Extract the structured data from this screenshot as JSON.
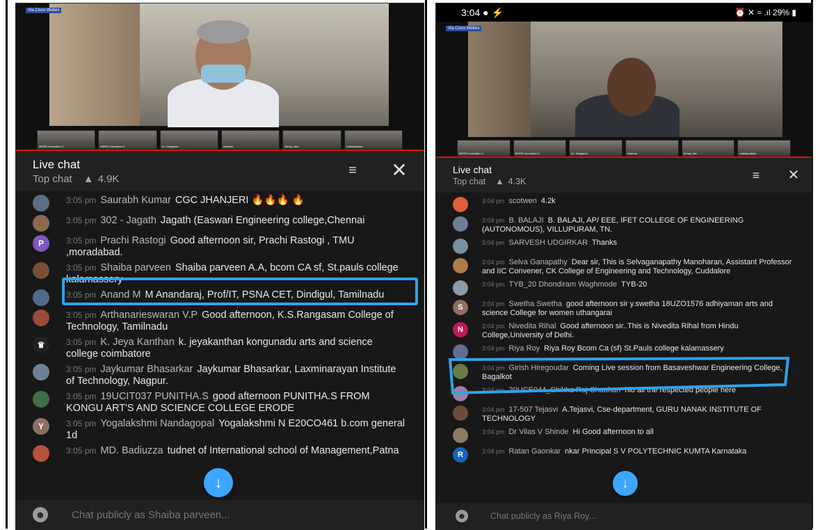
{
  "left": {
    "watermark": "Via Cisco Webex",
    "thumbs": [
      "MHRD Innovation C",
      "MHRD Innovation C",
      "Dr. Dangaran",
      "ishanan",
      "Abhay Jain",
      "mahlapraklas"
    ],
    "chat_title": "Live chat",
    "chat_mode": "Top chat",
    "viewer_count": "4.9K",
    "messages": [
      {
        "time": "3:05 pm",
        "author": "Saurabh Kumar",
        "text": "CGC JHANJERI 🔥🔥🔥 🔥",
        "avatar_color": "#5b6e86",
        "avatar_letter": ""
      },
      {
        "time": "3:05 pm",
        "author": "302 - Jagath",
        "text": "Jagath (Easwari Engineering college,Chennai",
        "avatar_color": "#8b6a4e",
        "avatar_letter": ""
      },
      {
        "time": "3:05 pm",
        "author": "Prachi Rastogi",
        "text": "Good afternoon sir, Prachi Rastogi , TMU ,moradabad.",
        "avatar_color": "#7e57c2",
        "avatar_letter": "P"
      },
      {
        "time": "3:05 pm",
        "author": "Shaiba parveen",
        "text": "Shaiba parveen A.A, bcom CA sf, St.pauls college kalamassery",
        "avatar_color": "#7a4e36",
        "avatar_letter": ""
      },
      {
        "time": "3:05 pm",
        "author": "Anand M",
        "text": "M Anandaraj, Prof/IT, PSNA CET, Dindigul, Tamilnadu",
        "avatar_color": "#4f6a8a",
        "avatar_letter": ""
      },
      {
        "time": "3:05 pm",
        "author": "Arthanarieswaran V.P",
        "text": "Good afternoon, K.S.Rangasam College of Technology, Tamilnadu",
        "avatar_color": "#9a4b3c",
        "avatar_letter": ""
      },
      {
        "time": "3:05 pm",
        "author": "K. Jeya Kanthan",
        "text": "k. jeyakanthan kongunadu arts and science college coimbatore",
        "avatar_color": "#222222",
        "avatar_letter": "♛"
      },
      {
        "time": "3:05 pm",
        "author": "Jaykumar Bhasarkar",
        "text": "Jaykumar Bhasarkar, Laxminarayan Institute of Technology, Nagpur.",
        "avatar_color": "#6c7f96",
        "avatar_letter": ""
      },
      {
        "time": "3:05 pm",
        "author": "19UCIT037 PUNITHA.S",
        "text": "good afternoon PUNITHA.S FROM KONGU ART'S AND SCIENCE COLLEGE ERODE",
        "avatar_color": "#3f6e4a",
        "avatar_letter": ""
      },
      {
        "time": "3:05 pm",
        "author": "Yogalakshmi Nandagopal",
        "text": "Yogalakshmi N E20CO461 b.com general 1d",
        "avatar_color": "#8d6e63",
        "avatar_letter": "Y"
      },
      {
        "time": "3:05 pm",
        "author": "MD. Badiuzza",
        "text": "tudnet of International school of Management,Patna",
        "avatar_color": "#b5533c",
        "avatar_letter": ""
      }
    ],
    "input_placeholder": "Chat publicly as Shaiba parveen..."
  },
  "right": {
    "status_time": "3:04",
    "status_battery": "29%",
    "watermark": "Via Cisco Webex",
    "thumbs": [
      "MHRD Innovation C",
      "MHRD Innovation C",
      "Dr. Dangaran",
      "ishanan",
      "Abhay Jain",
      "mahlapraklas"
    ],
    "chat_title": "Live chat",
    "chat_mode": "Top chat",
    "viewer_count": "4.3K",
    "messages": [
      {
        "time": "3:04 pm",
        "author": "scotwen",
        "text": "4.2k",
        "avatar_color": "#e0603a",
        "avatar_letter": ""
      },
      {
        "time": "3:04 pm",
        "author": "B. BALAJI",
        "text": "B. BALAJI, AP/ EEE, IFET COLLEGE OF ENGINEERING (AUTONOMOUS), VILLUPURAM, TN.",
        "avatar_color": "#6d7f95",
        "avatar_letter": ""
      },
      {
        "time": "3:04 pm",
        "author": "SARVESH UDGIRKAR",
        "text": "Thanks",
        "avatar_color": "#7a8f9f",
        "avatar_letter": ""
      },
      {
        "time": "3:04 pm",
        "author": "Selva Ganapathy",
        "text": "Dear sir, This is Selvaganapathy Manoharan, Assistant Professor and IIC Convener, CK College of Engineering and Technology, Cuddalore",
        "avatar_color": "#b07a4a",
        "avatar_letter": ""
      },
      {
        "time": "3:04 pm",
        "author": "TYB_20 Dhondiram Waghmode",
        "text": "TYB-20",
        "avatar_color": "#8a9aa6",
        "avatar_letter": ""
      },
      {
        "time": "3:04 pm",
        "author": "Swetha Swetha",
        "text": "good afternoon sir y.swetha 18UZO1576 adhiyaman arts and science College for women uthangarai",
        "avatar_color": "#8d6e63",
        "avatar_letter": "S"
      },
      {
        "time": "3:04 pm",
        "author": "Nivedita Rihal",
        "text": "Good afternoon sir..This is Nivedita Rihal from Hindu College,University of Delhi.",
        "avatar_color": "#c2185b",
        "avatar_letter": "N"
      },
      {
        "time": "3:04 pm",
        "author": "Riya Roy",
        "text": "Riya Roy Bcom Ca (sf) St.Pauls college kalamassery",
        "avatar_color": "#5f6f8c",
        "avatar_letter": ""
      },
      {
        "time": "3:04 pm",
        "author": "Girish Hiregoudar",
        "text": "Coming Live session from Basaveshwar Engineering College, Bagalkot",
        "avatar_color": "#6a7b4a",
        "avatar_letter": ""
      },
      {
        "time": "3:04 pm",
        "author": "20UCE044_Shikha Raj Chauhan",
        "text": "hlo all the respected people here",
        "avatar_color": "#9b7da8",
        "avatar_letter": ""
      },
      {
        "time": "3:04 pm",
        "author": "17-507 Tejasvi",
        "text": "A.Tejasvi, Cse-department, GURU NANAK INSTITUTE OF TECHNOLOGY",
        "avatar_color": "#6b4e3a",
        "avatar_letter": ""
      },
      {
        "time": "3:04 pm",
        "author": "Dr Vilas V Shinde",
        "text": "Hi Good afternoon to all",
        "avatar_color": "#8a7b62",
        "avatar_letter": ""
      },
      {
        "time": "3:04 pm",
        "author": "Ratan Gaonkar",
        "text": "nkar Principal S V POLYTECHNIC KUMTA Karnataka",
        "avatar_color": "#1565c0",
        "avatar_letter": "R"
      }
    ],
    "input_placeholder": "Chat publicly as Riya Roy..."
  },
  "colors": {
    "highlight": "#2ea3e8",
    "fab": "#3ea6ff",
    "progress": "#dd1111"
  }
}
